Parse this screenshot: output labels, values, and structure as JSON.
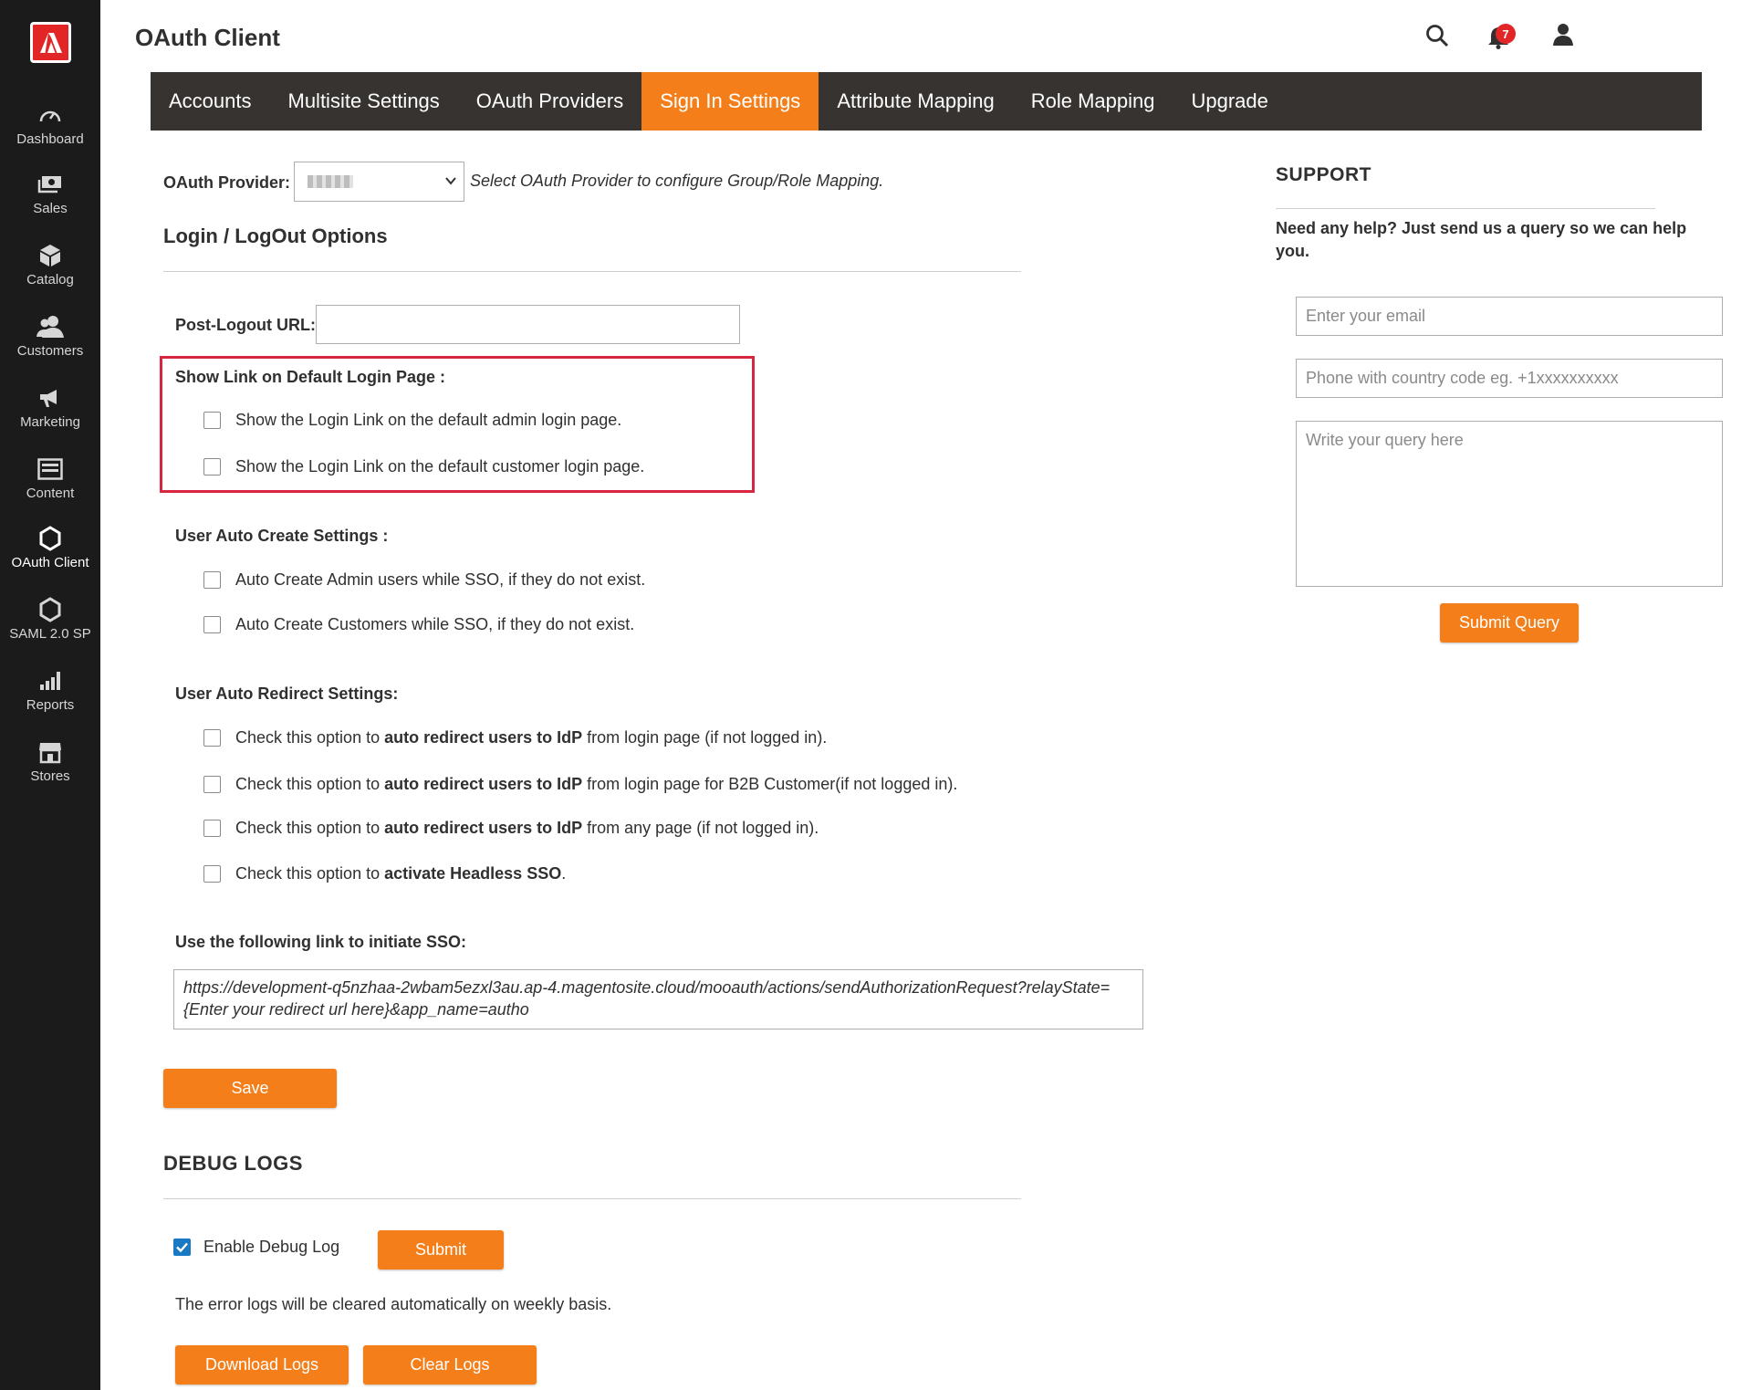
{
  "sidebar": {
    "items": [
      {
        "label": "Dashboard",
        "icon": "dashboard-icon"
      },
      {
        "label": "Sales",
        "icon": "sales-icon"
      },
      {
        "label": "Catalog",
        "icon": "catalog-icon"
      },
      {
        "label": "Customers",
        "icon": "customers-icon"
      },
      {
        "label": "Marketing",
        "icon": "marketing-icon"
      },
      {
        "label": "Content",
        "icon": "content-icon"
      },
      {
        "label": "OAuth Client",
        "icon": "hexagon-icon"
      },
      {
        "label": "SAML 2.0 SP",
        "icon": "hexagon-icon"
      },
      {
        "label": "Reports",
        "icon": "reports-icon"
      },
      {
        "label": "Stores",
        "icon": "stores-icon"
      }
    ],
    "active": "OAuth Client"
  },
  "header": {
    "title": "OAuth Client",
    "notification_count": "7"
  },
  "tabs": [
    "Accounts",
    "Multisite Settings",
    "OAuth Providers",
    "Sign In Settings",
    "Attribute Mapping",
    "Role Mapping",
    "Upgrade"
  ],
  "active_tab": "Sign In Settings",
  "form": {
    "provider_label": "OAuth Provider:",
    "provider_hint": "Select OAuth Provider to configure Group/Role Mapping.",
    "login_section_title": "Login / LogOut Options",
    "post_logout_label": "Post-Logout URL:",
    "post_logout_value": "",
    "show_link_label": "Show Link on Default Login Page :",
    "show_link_admin": "Show the Login Link on the default admin login page.",
    "show_link_customer": "Show the Login Link on the default customer login page.",
    "auto_create_label": "User Auto Create Settings :",
    "auto_create_admin": "Auto Create Admin users while SSO, if they do not exist.",
    "auto_create_customers": "Auto Create Customers while SSO, if they do not exist.",
    "auto_redirect_label": "User Auto Redirect Settings:",
    "redirect_prefix": "Check this option to ",
    "redirect_bold": "auto redirect users to IdP",
    "redirect_1_suffix": " from login page (if not logged in).",
    "redirect_2_suffix": " from login page for B2B Customer(if not logged in).",
    "redirect_3_suffix": " from any page (if not logged in).",
    "headless_bold": "activate Headless SSO",
    "headless_suffix": ".",
    "sso_link_label": "Use the following link to initiate SSO:",
    "sso_link": "https://development-q5nzhaa-2wbam5ezxl3au.ap-4.magentosite.cloud/mooauth/actions/sendAuthorizationRequest?relayState={Enter your redirect url here}&app_name=autho",
    "save_button": "Save"
  },
  "debug": {
    "title": "DEBUG LOGS",
    "enable_label": "Enable Debug Log",
    "enabled": true,
    "submit_button": "Submit",
    "note": "The error logs will be cleared automatically on weekly basis.",
    "download_button": "Download Logs",
    "clear_button": "Clear Logs"
  },
  "support": {
    "title": "SUPPORT",
    "text": "Need any help? Just send us a query so we can help you.",
    "email_placeholder": "Enter your email",
    "phone_placeholder": "Phone with country code eg. +1xxxxxxxxxx",
    "query_placeholder": "Write your query here",
    "submit_button": "Submit Query"
  },
  "colors": {
    "accent": "#f47f1a",
    "sidebar_bg": "#1b1b1b",
    "tabbar_bg": "#373330",
    "highlight": "#d7263d"
  }
}
